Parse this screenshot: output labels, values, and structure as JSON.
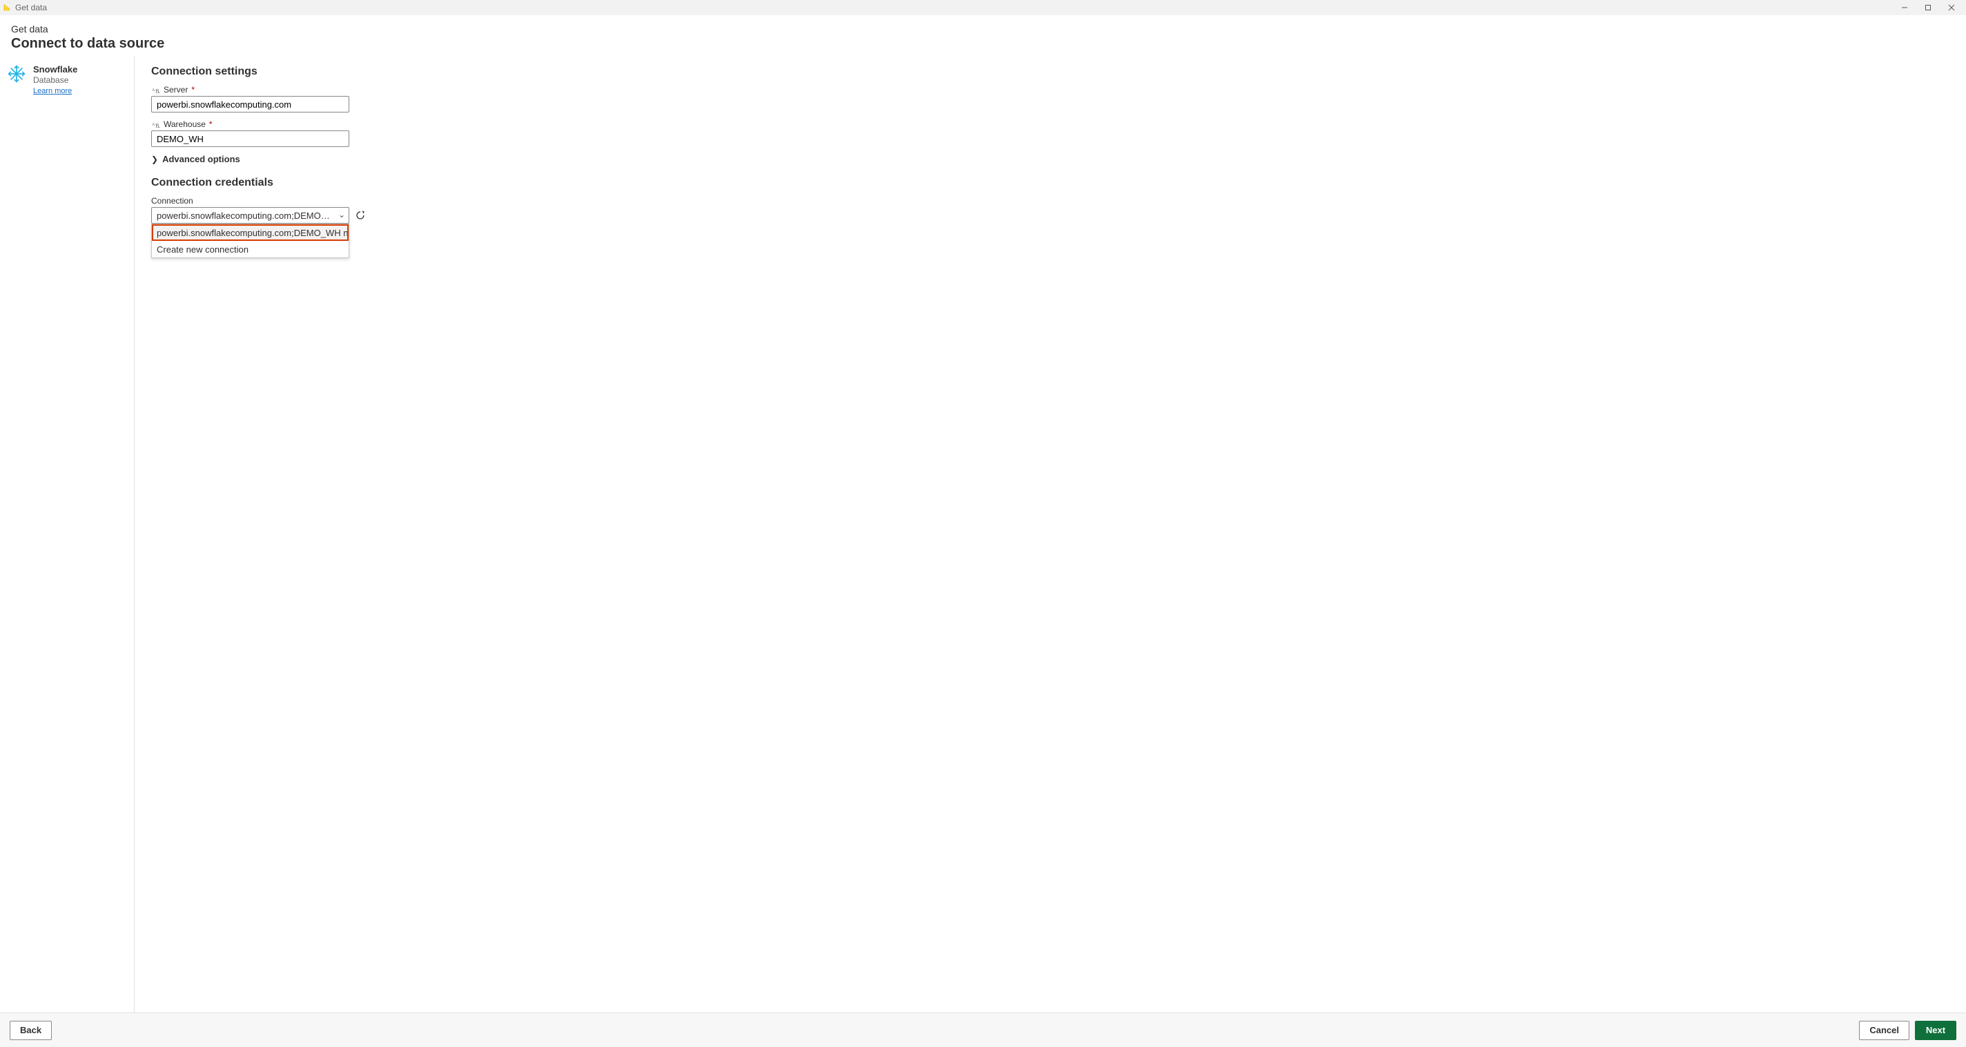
{
  "titlebar": {
    "text": "Get data"
  },
  "header": {
    "sub": "Get data",
    "title": "Connect to data source"
  },
  "sidebar": {
    "name": "Snowflake",
    "type": "Database",
    "learn_more": "Learn more"
  },
  "settings": {
    "heading": "Connection settings",
    "server_label": "Server",
    "server_value": "powerbi.snowflakecomputing.com",
    "warehouse_label": "Warehouse",
    "warehouse_value": "DEMO_WH",
    "advanced_label": "Advanced options"
  },
  "credentials": {
    "heading": "Connection credentials",
    "connection_label": "Connection",
    "selected": "powerbi.snowflakecomputing.com;DEMO_WH nisriniva...",
    "options": [
      "powerbi.snowflakecomputing.com;DEMO_WH nisrinivasan (...",
      "Create new connection"
    ]
  },
  "footer": {
    "back": "Back",
    "cancel": "Cancel",
    "next": "Next"
  }
}
